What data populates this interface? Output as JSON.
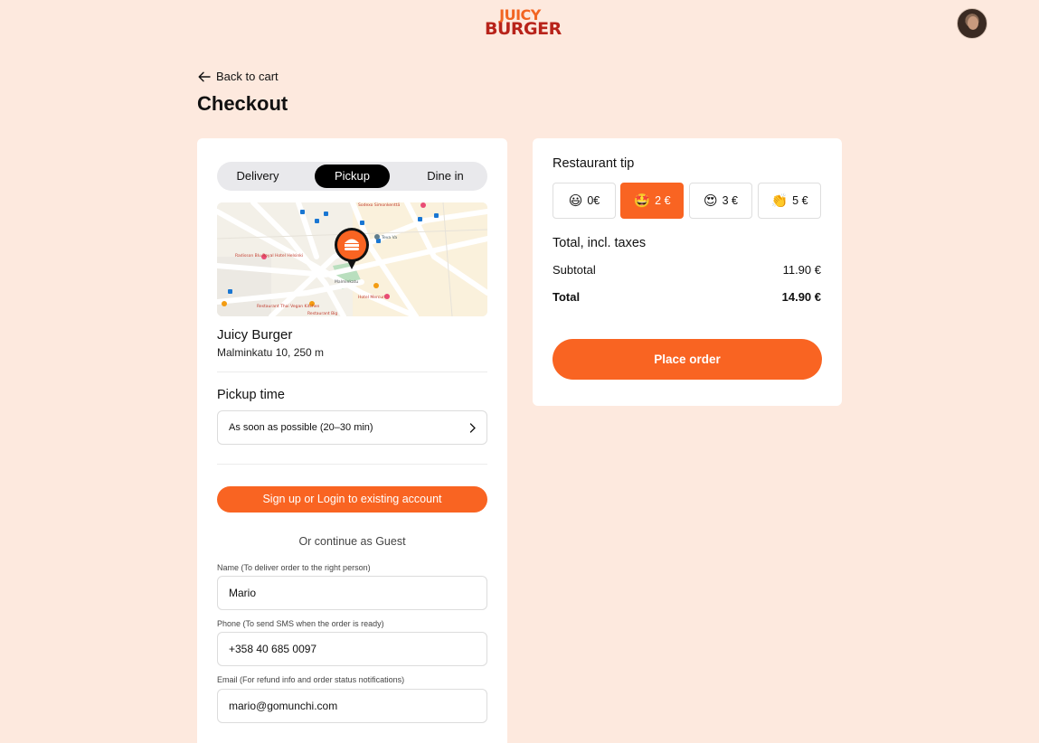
{
  "header": {
    "logo_line1": "JUICY",
    "logo_line2": "BURGER",
    "avatar_icon": "user-avatar"
  },
  "nav": {
    "back_label": "Back to cart"
  },
  "page": {
    "title": "Checkout"
  },
  "order_type": {
    "options": [
      "Delivery",
      "Pickup",
      "Dine in"
    ],
    "selected": "Pickup"
  },
  "map": {
    "labels": {
      "restaurant_a": "Radisson Blu Royal Hotel Helsinki",
      "restaurant_b": "Restaurant Thai Vegan Kitchen",
      "restaurant_c": "Restaurant Big",
      "hotel": "Hotel Mercuri",
      "place": "Teva Va",
      "cafe": "Sodexo Simonkenttä",
      "street": "Malminkatu"
    }
  },
  "restaurant": {
    "name": "Juicy Burger",
    "address": "Malminkatu 10, 250 m"
  },
  "pickup": {
    "label": "Pickup time",
    "value": "As soon as possible (20–30 min)"
  },
  "account": {
    "signup_label": "Sign up or Login to existing account",
    "guest_label": "Or continue as Guest"
  },
  "form": {
    "name_label": "Name (To deliver order to the right person)",
    "name_value": "Mario",
    "phone_label": "Phone (To send SMS when the order is ready)",
    "phone_value": "+358 40 685 0097",
    "email_label": "Email (For refund info and order status notifications)",
    "email_value": "mario@gomunchi.com"
  },
  "tip": {
    "title": "Restaurant tip",
    "options": [
      {
        "emoji": "😃",
        "label": "0€"
      },
      {
        "emoji": "🤩",
        "label": "2 €"
      },
      {
        "emoji": "😍",
        "label": "3 €"
      },
      {
        "emoji": "👏",
        "label": "5 €"
      }
    ],
    "selected_index": 1
  },
  "totals": {
    "title": "Total, incl. taxes",
    "subtotal_label": "Subtotal",
    "subtotal_value": "11.90 €",
    "total_label": "Total",
    "total_value": "14.90 €"
  },
  "actions": {
    "place_order": "Place order"
  },
  "colors": {
    "background": "#fde9de",
    "accent": "#f96422",
    "logo_orange": "#f26522",
    "logo_red": "#b8231a"
  }
}
